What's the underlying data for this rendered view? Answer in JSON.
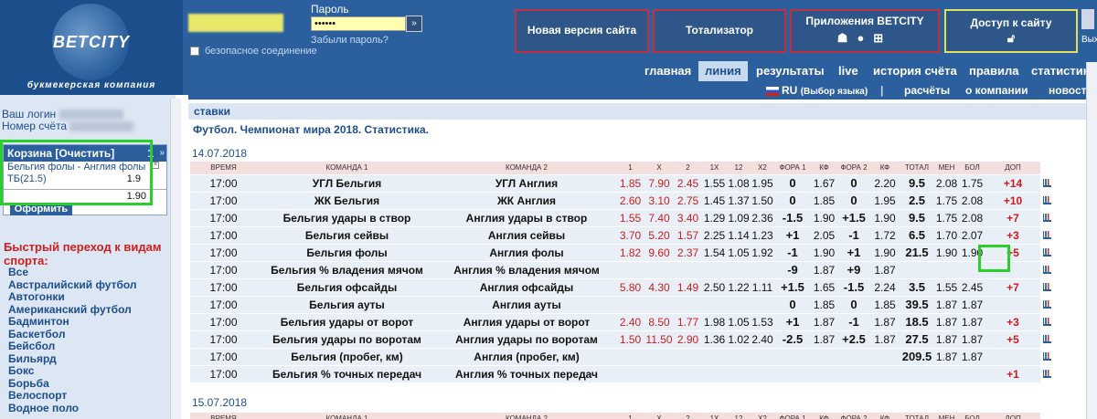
{
  "header": {
    "logo_text": "BETCITY",
    "logo_subtitle": "букмекерская компания",
    "password_label": "Пароль",
    "password_value": "••••••",
    "forgot_password": "Забыли пароль?",
    "secure_connection": "безопасное соединение",
    "buttons": {
      "new_version": "Новая версия сайта",
      "totalizator": "Тотализатор",
      "apps": "Приложения BETCITY",
      "access": "Доступ к сайту",
      "exit": "Вых"
    }
  },
  "nav_main": [
    "главная",
    "линия",
    "результаты",
    "live",
    "история счёта",
    "правила",
    "статистика"
  ],
  "nav_sub": {
    "lang": "RU",
    "lang_choice": "(Выбор языка)",
    "items": [
      "расчёты",
      "о компании",
      "новости"
    ]
  },
  "left": {
    "login_label": "Ваш логин",
    "account_label": "Номер счёта",
    "cart": {
      "title": "Корзина [Очистить]",
      "count": "1",
      "bet_event": "Бельгия фолы - Англия фолы",
      "bet_type": "ТБ(21.5)",
      "bet_odd": "1.9",
      "total": "1.90",
      "submit": "Оформить"
    },
    "quick_title": "Быстрый переход к видам спорта:",
    "sports": [
      "Все",
      "Австралийский футбол",
      "Автогонки",
      "Американский футбол",
      "Бадминтон",
      "Баскетбол",
      "Бейсбол",
      "Бильярд",
      "Бокс",
      "Борьба",
      "Велоспорт",
      "Водное поло"
    ]
  },
  "main": {
    "section": "ставки",
    "title": "Футбол. Чемпионат мира 2018. Статистика.",
    "date1": "14.07.2018",
    "date2": "15.07.2018",
    "columns": [
      "ВРЕМЯ",
      "КОМАНДА 1",
      "КОМАНДА 2",
      "1",
      "X",
      "2",
      "1X",
      "12",
      "X2",
      "ФОРА 1",
      "КФ",
      "ФОРА 2",
      "КФ",
      "ТОТАЛ",
      "МЕН",
      "БОЛ",
      "ДОП"
    ],
    "rows": [
      [
        "17:00",
        "УГЛ Бельгия",
        "УГЛ Англия",
        "1.85",
        "7.90",
        "2.45",
        "1.55",
        "1.08",
        "1.95",
        "0",
        "1.67",
        "0",
        "2.20",
        "9.5",
        "2.08",
        "1.75",
        "+14"
      ],
      [
        "17:00",
        "ЖК Бельгия",
        "ЖК Англия",
        "2.60",
        "3.10",
        "2.75",
        "1.45",
        "1.37",
        "1.50",
        "0",
        "1.85",
        "0",
        "1.95",
        "2.5",
        "1.75",
        "2.08",
        "+10"
      ],
      [
        "17:00",
        "Бельгия удары в створ",
        "Англия удары в створ",
        "1.55",
        "7.40",
        "3.40",
        "1.29",
        "1.09",
        "2.36",
        "-1.5",
        "1.90",
        "+1.5",
        "1.90",
        "9.5",
        "1.75",
        "2.08",
        "+7"
      ],
      [
        "17:00",
        "Бельгия сейвы",
        "Англия сейвы",
        "3.70",
        "5.20",
        "1.57",
        "2.25",
        "1.14",
        "1.23",
        "+1",
        "2.05",
        "-1",
        "1.72",
        "6.5",
        "1.70",
        "2.07",
        "+3"
      ],
      [
        "17:00",
        "Бельгия фолы",
        "Англия фолы",
        "1.82",
        "9.60",
        "2.37",
        "1.54",
        "1.05",
        "1.92",
        "-1",
        "1.90",
        "+1",
        "1.90",
        "21.5",
        "1.90",
        "1.90",
        "+5"
      ],
      [
        "17:00",
        "Бельгия % владения мячом",
        "Англия % владения мячом",
        "",
        "",
        "",
        "",
        "",
        "",
        "-9",
        "1.87",
        "+9",
        "1.87",
        "",
        "",
        "",
        ""
      ],
      [
        "17:00",
        "Бельгия офсайды",
        "Англия офсайды",
        "5.80",
        "4.30",
        "1.49",
        "2.50",
        "1.22",
        "1.11",
        "+1.5",
        "1.65",
        "-1.5",
        "2.24",
        "3.5",
        "1.55",
        "2.45",
        "+7"
      ],
      [
        "17:00",
        "Бельгия ауты",
        "Англия ауты",
        "",
        "",
        "",
        "",
        "",
        "",
        "0",
        "1.85",
        "0",
        "1.85",
        "39.5",
        "1.87",
        "1.87",
        ""
      ],
      [
        "17:00",
        "Бельгия удары от ворот",
        "Англия удары от ворот",
        "2.40",
        "8.50",
        "1.77",
        "1.98",
        "1.05",
        "1.53",
        "+1",
        "1.87",
        "-1",
        "1.87",
        "18.5",
        "1.87",
        "1.87",
        "+3"
      ],
      [
        "17:00",
        "Бельгия удары по воротам",
        "Англия удары по воротам",
        "1.50",
        "11.50",
        "2.90",
        "1.36",
        "1.02",
        "2.40",
        "-2.5",
        "1.87",
        "+2.5",
        "1.87",
        "27.5",
        "1.87",
        "1.87",
        "+5"
      ],
      [
        "17:00",
        "Бельгия (пробег, км)",
        "Англия (пробег, км)",
        "",
        "",
        "",
        "",
        "",
        "",
        "",
        "",
        "",
        "",
        "209.5",
        "1.87",
        "1.87",
        ""
      ],
      [
        "17:00",
        "Бельгия % точных передач",
        "Англия % точных передач",
        "",
        "",
        "",
        "",
        "",
        "",
        "",
        "",
        "",
        "",
        "",
        "",
        "",
        "+1"
      ]
    ]
  },
  "colors": {
    "brand_blue": "#2b5f9e",
    "odd_red": "#c81e1e",
    "highlight_green": "#28d028"
  }
}
